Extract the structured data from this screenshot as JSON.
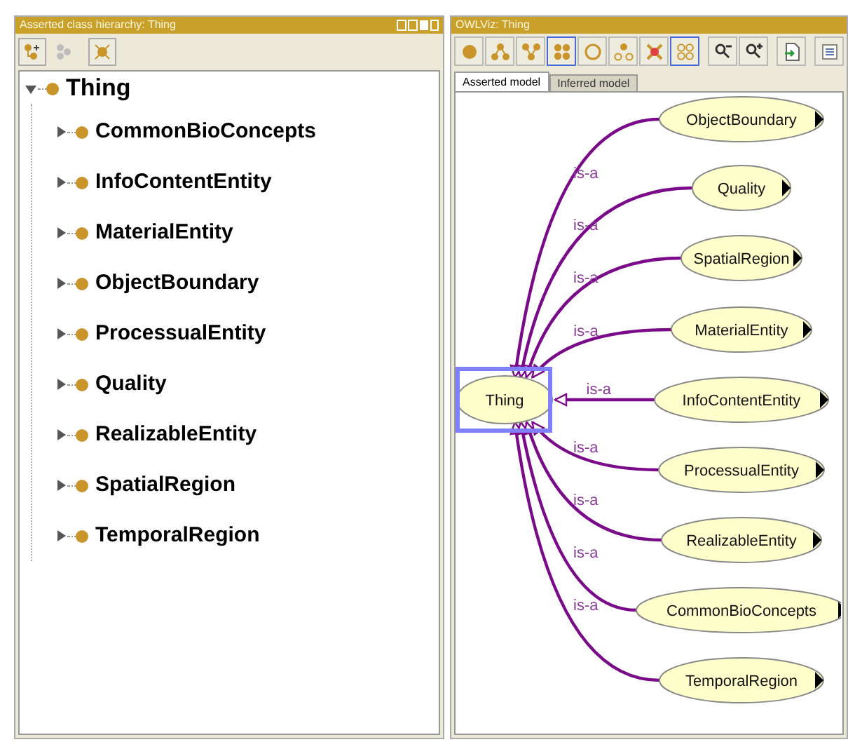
{
  "hierarchy_panel": {
    "title": "Asserted class hierarchy: Thing",
    "toolbar": [
      {
        "kind": "add-sub",
        "disabled": false
      },
      {
        "kind": "add-sibling",
        "disabled": true
      },
      {
        "kind": "delete",
        "disabled": false
      }
    ],
    "tree": [
      {
        "label": "Thing",
        "expanded": true,
        "children": [
          {
            "label": "CommonBioConcepts",
            "expanded": false
          },
          {
            "label": "InfoContentEntity",
            "expanded": false
          },
          {
            "label": "MaterialEntity",
            "expanded": false
          },
          {
            "label": "ObjectBoundary",
            "expanded": false
          },
          {
            "label": "ProcessualEntity",
            "expanded": false
          },
          {
            "label": "Quality",
            "expanded": false
          },
          {
            "label": "RealizableEntity",
            "expanded": false
          },
          {
            "label": "SpatialRegion",
            "expanded": false
          },
          {
            "label": "TemporalRegion",
            "expanded": false
          }
        ]
      }
    ]
  },
  "viz_panel": {
    "title": "OWLViz: Thing",
    "toolbar": [
      {
        "kind": "dot",
        "selected": false
      },
      {
        "kind": "tree",
        "selected": false
      },
      {
        "kind": "fork",
        "selected": false
      },
      {
        "kind": "grid",
        "selected": true
      },
      {
        "kind": "ring",
        "selected": false
      },
      {
        "kind": "tree-ring",
        "selected": false
      },
      {
        "kind": "cross",
        "selected": false
      },
      {
        "kind": "grid-ring",
        "selected": true
      },
      {
        "kind": "zoom-out",
        "selected": false
      },
      {
        "kind": "zoom-in",
        "selected": false
      },
      {
        "kind": "export",
        "selected": false
      },
      {
        "kind": "list",
        "selected": false
      }
    ],
    "tabs": [
      {
        "label": "Asserted model",
        "selected": true
      },
      {
        "label": "Inferred model",
        "selected": false
      }
    ],
    "graph": {
      "root": {
        "label": "Thing",
        "selected": true
      },
      "nodes": [
        {
          "label": "ObjectBoundary",
          "edge_label": "is-a"
        },
        {
          "label": "Quality",
          "edge_label": "is-a"
        },
        {
          "label": "SpatialRegion",
          "edge_label": "is-a"
        },
        {
          "label": "MaterialEntity",
          "edge_label": "is-a"
        },
        {
          "label": "InfoContentEntity",
          "edge_label": "is-a"
        },
        {
          "label": "ProcessualEntity",
          "edge_label": "is-a"
        },
        {
          "label": "RealizableEntity",
          "edge_label": "is-a"
        },
        {
          "label": "CommonBioConcepts",
          "edge_label": "is-a"
        },
        {
          "label": "TemporalRegion",
          "edge_label": "is-a"
        }
      ]
    }
  }
}
